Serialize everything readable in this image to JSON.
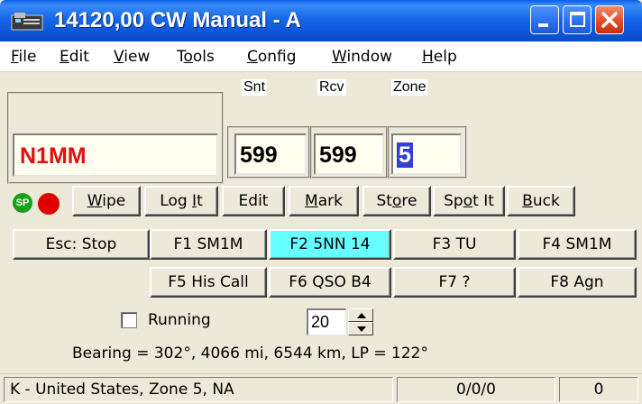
{
  "window": {
    "title": "14120,00 CW Manual - A"
  },
  "menu": {
    "items": [
      {
        "accel": "F",
        "rest": "ile"
      },
      {
        "accel": "E",
        "rest": "dit"
      },
      {
        "accel": "V",
        "rest": "iew"
      },
      {
        "pre": "T",
        "accel": "o",
        "rest": "ols"
      },
      {
        "accel": "C",
        "rest": "onfig"
      },
      {
        "accel": "W",
        "rest": "indow"
      },
      {
        "accel": "H",
        "rest": "elp"
      }
    ]
  },
  "entry": {
    "callsign": "N1MM",
    "snt_label": "Snt",
    "rcv_label": "Rcv",
    "zone_label": "Zone",
    "snt_value": "599",
    "rcv_value": "599",
    "zone_value": "5"
  },
  "status_icons": {
    "sp_text": "SP"
  },
  "action_buttons": {
    "wipe_accel": "W",
    "wipe_rest": "ipe",
    "logit_pre": "Log ",
    "logit_accel": "I",
    "logit_rest": "t",
    "edit": "Edit",
    "mark_accel": "M",
    "mark_rest": "ark",
    "store_pre": "St",
    "store_accel": "o",
    "store_rest": "re",
    "spotit_pre": "Sp",
    "spotit_accel": "o",
    "spotit_rest": "t It",
    "buck_accel": "B",
    "buck_rest": "uck"
  },
  "function_keys": {
    "esc": "Esc: Stop",
    "f1": "F1 SM1M",
    "f2": "F2 5NN 14",
    "f3": "F3 TU",
    "f4": "F4 SM1M",
    "f5": "F5 His Call",
    "f6": "F6 QSO B4",
    "f7": "F7 ?",
    "f8": "F8 Agn"
  },
  "options": {
    "running_label": "Running",
    "running_checked": false,
    "speed_value": "20"
  },
  "bearing_text": "Bearing = 302°, 4066  mi, 6544 km, LP = 122°",
  "statusbar": {
    "country": "K - United States, Zone 5, NA",
    "counts": "0/0/0",
    "count2": "0"
  },
  "colors": {
    "callsign": "#e01010",
    "highlight_button": "#66ffff",
    "titlebar": "#0b54d8"
  }
}
